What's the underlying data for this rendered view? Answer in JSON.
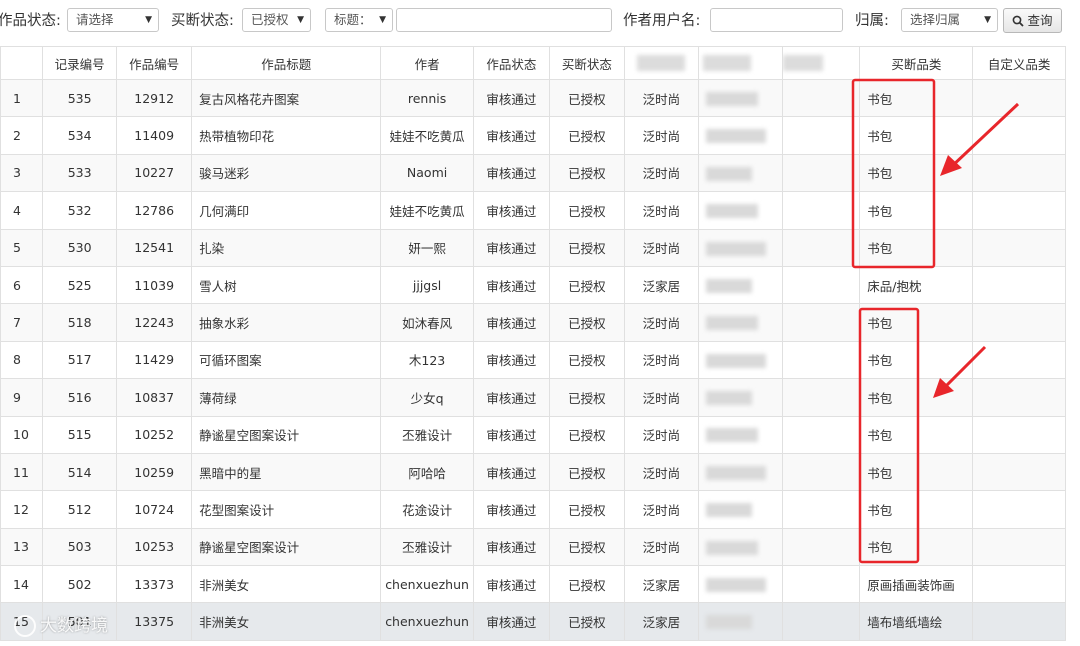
{
  "filters": {
    "work_status_label": "作品状态:",
    "work_status_value": "请选择",
    "buyout_status_label": "买断状态:",
    "buyout_status_value": "已授权",
    "title_select_value": "标题：",
    "title_input_value": "",
    "author_label": "作者用户名:",
    "author_input_value": "",
    "belong_label": "归属:",
    "belong_value": "选择归属",
    "search_button": "查询"
  },
  "table": {
    "headers": [
      "记录编号",
      "作品编号",
      "作品标题",
      "作者",
      "作品状态",
      "买断状态",
      "",
      "",
      "买断品类",
      "自定义品类"
    ],
    "rows": [
      {
        "seq": "1",
        "record": "535",
        "work": "12912",
        "title": "复古风格花卉图案",
        "author": "rennis",
        "status": "审核通过",
        "buyout": "已授权",
        "belong": "泛时尚",
        "category": "书包",
        "custom": ""
      },
      {
        "seq": "2",
        "record": "534",
        "work": "11409",
        "title": "热带植物印花",
        "author": "娃娃不吃黄瓜",
        "status": "审核通过",
        "buyout": "已授权",
        "belong": "泛时尚",
        "category": "书包",
        "custom": ""
      },
      {
        "seq": "3",
        "record": "533",
        "work": "10227",
        "title": "骏马迷彩",
        "author": "Naomi",
        "status": "审核通过",
        "buyout": "已授权",
        "belong": "泛时尚",
        "category": "书包",
        "custom": ""
      },
      {
        "seq": "4",
        "record": "532",
        "work": "12786",
        "title": "几何满印",
        "author": "娃娃不吃黄瓜",
        "status": "审核通过",
        "buyout": "已授权",
        "belong": "泛时尚",
        "category": "书包",
        "custom": ""
      },
      {
        "seq": "5",
        "record": "530",
        "work": "12541",
        "title": "扎染",
        "author": "妍一熙",
        "status": "审核通过",
        "buyout": "已授权",
        "belong": "泛时尚",
        "category": "书包",
        "custom": ""
      },
      {
        "seq": "6",
        "record": "525",
        "work": "11039",
        "title": "雪人树",
        "author": "jjjgsl",
        "status": "审核通过",
        "buyout": "已授权",
        "belong": "泛家居",
        "category": "床品/抱枕",
        "custom": ""
      },
      {
        "seq": "7",
        "record": "518",
        "work": "12243",
        "title": "抽象水彩",
        "author": "如沐春风",
        "status": "审核通过",
        "buyout": "已授权",
        "belong": "泛时尚",
        "category": "书包",
        "custom": ""
      },
      {
        "seq": "8",
        "record": "517",
        "work": "11429",
        "title": "可循环图案",
        "author": "木123",
        "status": "审核通过",
        "buyout": "已授权",
        "belong": "泛时尚",
        "category": "书包",
        "custom": ""
      },
      {
        "seq": "9",
        "record": "516",
        "work": "10837",
        "title": "薄荷绿",
        "author": "少女q",
        "status": "审核通过",
        "buyout": "已授权",
        "belong": "泛时尚",
        "category": "书包",
        "custom": ""
      },
      {
        "seq": "10",
        "record": "515",
        "work": "10252",
        "title": "静谧星空图案设计",
        "author": "丕雅设计",
        "status": "审核通过",
        "buyout": "已授权",
        "belong": "泛时尚",
        "category": "书包",
        "custom": ""
      },
      {
        "seq": "11",
        "record": "514",
        "work": "10259",
        "title": "黑暗中的星",
        "author": "阿哈哈",
        "status": "审核通过",
        "buyout": "已授权",
        "belong": "泛时尚",
        "category": "书包",
        "custom": ""
      },
      {
        "seq": "12",
        "record": "512",
        "work": "10724",
        "title": "花型图案设计",
        "author": "花途设计",
        "status": "审核通过",
        "buyout": "已授权",
        "belong": "泛时尚",
        "category": "书包",
        "custom": ""
      },
      {
        "seq": "13",
        "record": "503",
        "work": "10253",
        "title": "静谧星空图案设计",
        "author": "丕雅设计",
        "status": "审核通过",
        "buyout": "已授权",
        "belong": "泛时尚",
        "category": "书包",
        "custom": ""
      },
      {
        "seq": "14",
        "record": "502",
        "work": "13373",
        "title": "非洲美女",
        "author": "chenxuezhun",
        "status": "审核通过",
        "buyout": "已授权",
        "belong": "泛家居",
        "category": "原画插画装饰画",
        "custom": ""
      },
      {
        "seq": "15",
        "record": "501",
        "work": "13375",
        "title": "非洲美女",
        "author": "chenxuezhun",
        "status": "审核通过",
        "buyout": "已授权",
        "belong": "泛家居",
        "category": "墙布墙纸墙绘",
        "custom": ""
      }
    ]
  },
  "annotation": {
    "color": "#e8262b"
  },
  "watermark": {
    "text": "大数跨境"
  }
}
